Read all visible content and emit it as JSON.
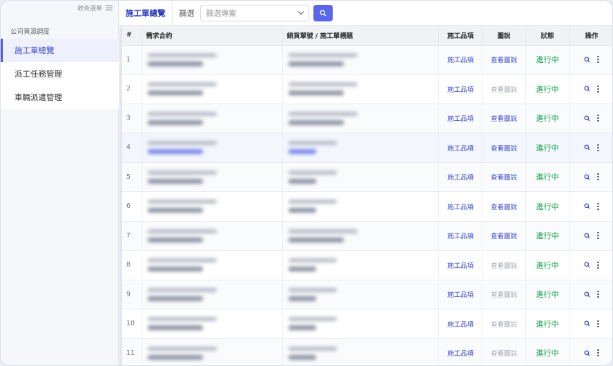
{
  "sidebar": {
    "collapse_label": "收合選單",
    "group_label": "公司資源調度",
    "items": [
      {
        "label": "施工單總覽",
        "active": true
      },
      {
        "label": "派工任務管理",
        "active": false
      },
      {
        "label": "車輛派遣管理",
        "active": false
      }
    ]
  },
  "topbar": {
    "page_tab": "施工單總覽",
    "filter_label": "篩選",
    "filter_placeholder": "篩選專案"
  },
  "table": {
    "headers": [
      "#",
      "需求合約",
      "銷貨單號 / 施工單標題",
      "施工品項",
      "圖說",
      "狀態",
      "操作"
    ],
    "rows": [
      {
        "num": "1",
        "items": "施工品項",
        "drawing": "查看圖說",
        "drawing_enabled": true,
        "status": "進行中"
      },
      {
        "num": "2",
        "items": "施工品項",
        "drawing": "查看圖說",
        "drawing_enabled": false,
        "status": "進行中"
      },
      {
        "num": "3",
        "items": "施工品項",
        "drawing": "查看圖說",
        "drawing_enabled": true,
        "status": "進行中"
      },
      {
        "num": "4",
        "items": "施工品項",
        "drawing": "查看圖說",
        "drawing_enabled": true,
        "status": "進行中"
      },
      {
        "num": "5",
        "items": "施工品項",
        "drawing": "查看圖說",
        "drawing_enabled": true,
        "status": "進行中"
      },
      {
        "num": "6",
        "items": "施工品項",
        "drawing": "查看圖說",
        "drawing_enabled": true,
        "status": "進行中"
      },
      {
        "num": "7",
        "items": "施工品項",
        "drawing": "查看圖說",
        "drawing_enabled": true,
        "status": "進行中"
      },
      {
        "num": "8",
        "items": "施工品項",
        "drawing": "查看圖說",
        "drawing_enabled": false,
        "status": "進行中"
      },
      {
        "num": "9",
        "items": "施工品項",
        "drawing": "查看圖說",
        "drawing_enabled": false,
        "status": "進行中"
      },
      {
        "num": "10",
        "items": "施工品項",
        "drawing": "查看圖說",
        "drawing_enabled": false,
        "status": "進行中"
      },
      {
        "num": "11",
        "items": "施工品項",
        "drawing": "查看圖說",
        "drawing_enabled": false,
        "status": "進行中"
      }
    ]
  },
  "colors": {
    "accent": "#4a57d9",
    "status_green": "#16a34a",
    "link_blue": "#3b48c7"
  }
}
